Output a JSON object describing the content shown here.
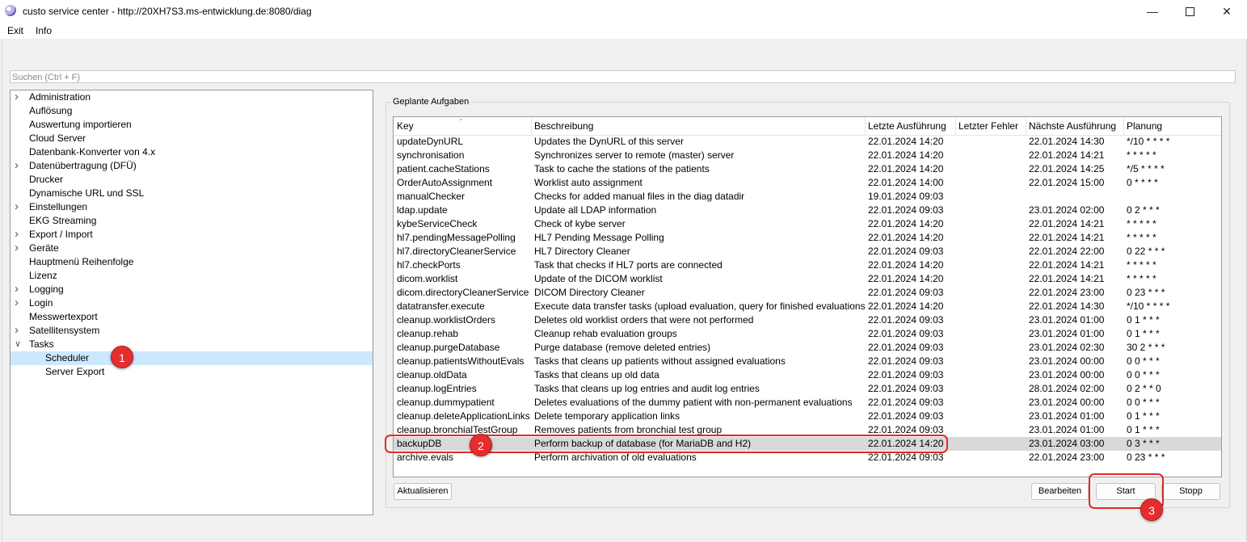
{
  "window": {
    "title": "custo service center - http://20XH7S3.ms-entwicklung.de:8080/diag"
  },
  "menu": {
    "items": [
      "Exit",
      "Info"
    ]
  },
  "search": {
    "placeholder": "Suchen (Ctrl + F)"
  },
  "tree": {
    "items": [
      {
        "label": "Administration",
        "expandable": true
      },
      {
        "label": "Auflösung",
        "expandable": false
      },
      {
        "label": "Auswertung importieren",
        "expandable": false
      },
      {
        "label": "Cloud Server",
        "expandable": false
      },
      {
        "label": "Datenbank-Konverter von 4.x",
        "expandable": false
      },
      {
        "label": "Datenübertragung (DFÜ)",
        "expandable": true
      },
      {
        "label": "Drucker",
        "expandable": false
      },
      {
        "label": "Dynamische URL und SSL",
        "expandable": false
      },
      {
        "label": "Einstellungen",
        "expandable": true
      },
      {
        "label": "EKG Streaming",
        "expandable": false
      },
      {
        "label": "Export / Import",
        "expandable": true
      },
      {
        "label": "Geräte",
        "expandable": true
      },
      {
        "label": "Hauptmenü Reihenfolge",
        "expandable": false
      },
      {
        "label": "Lizenz",
        "expandable": false
      },
      {
        "label": "Logging",
        "expandable": true
      },
      {
        "label": "Login",
        "expandable": true
      },
      {
        "label": "Messwertexport",
        "expandable": false
      },
      {
        "label": "Satellitensystem",
        "expandable": true
      },
      {
        "label": "Tasks",
        "expandable": true,
        "expanded": true
      },
      {
        "label": "Scheduler",
        "child": true,
        "selected": true
      },
      {
        "label": "Server Export",
        "child": true
      }
    ]
  },
  "panel": {
    "title": "Geplante Aufgaben"
  },
  "table": {
    "columns": [
      "Key",
      "Beschreibung",
      "Letzte Ausführung",
      "Letzter Fehler",
      "Nächste Ausführung",
      "Planung"
    ],
    "rows": [
      [
        "updateDynURL",
        "Updates the DynURL of this server",
        "22.01.2024 14:20",
        "",
        "22.01.2024 14:30",
        "*/10 * * * *"
      ],
      [
        "synchronisation",
        "Synchronizes server to remote (master) server",
        "22.01.2024 14:20",
        "",
        "22.01.2024 14:21",
        "* * * * *"
      ],
      [
        "patient.cacheStations",
        "Task to cache the stations of the patients",
        "22.01.2024 14:20",
        "",
        "22.01.2024 14:25",
        "*/5 * * * *"
      ],
      [
        "OrderAutoAssignment",
        "Worklist auto assignment",
        "22.01.2024 14:00",
        "",
        "22.01.2024 15:00",
        "0 * * * *"
      ],
      [
        "manualChecker",
        "Checks for added manual files in the diag datadir",
        "19.01.2024 09:03",
        "",
        "",
        ""
      ],
      [
        "ldap.update",
        "Update all LDAP information",
        "22.01.2024 09:03",
        "",
        "23.01.2024 02:00",
        "0 2 * * *"
      ],
      [
        "kybeServiceCheck",
        "Check of kybe server",
        "22.01.2024 14:20",
        "",
        "22.01.2024 14:21",
        "* * * * *"
      ],
      [
        "hl7.pendingMessagePolling",
        "HL7 Pending Message Polling",
        "22.01.2024 14:20",
        "",
        "22.01.2024 14:21",
        "* * * * *"
      ],
      [
        "hl7.directoryCleanerService",
        "HL7 Directory Cleaner",
        "22.01.2024 09:03",
        "",
        "22.01.2024 22:00",
        "0 22 * * *"
      ],
      [
        "hl7.checkPorts",
        "Task that checks if HL7 ports are connected",
        "22.01.2024 14:20",
        "",
        "22.01.2024 14:21",
        "* * * * *"
      ],
      [
        "dicom.worklist",
        "Update of the DICOM worklist",
        "22.01.2024 14:20",
        "",
        "22.01.2024 14:21",
        "* * * * *"
      ],
      [
        "dicom.directoryCleanerService",
        "DICOM Directory Cleaner",
        "22.01.2024 09:03",
        "",
        "22.01.2024 23:00",
        "0 23 * * *"
      ],
      [
        "datatransfer.execute",
        "Execute data transfer tasks (upload evaluation, query for finished evaluations)",
        "22.01.2024 14:20",
        "",
        "22.01.2024 14:30",
        "*/10 * * * *"
      ],
      [
        "cleanup.worklistOrders",
        "Deletes old worklist orders that were not performed",
        "22.01.2024 09:03",
        "",
        "23.01.2024 01:00",
        "0 1 * * *"
      ],
      [
        "cleanup.rehab",
        "Cleanup rehab evaluation groups",
        "22.01.2024 09:03",
        "",
        "23.01.2024 01:00",
        "0 1 * * *"
      ],
      [
        "cleanup.purgeDatabase",
        "Purge database (remove deleted entries)",
        "22.01.2024 09:03",
        "",
        "23.01.2024 02:30",
        "30 2 * * *"
      ],
      [
        "cleanup.patientsWithoutEvals",
        "Tasks that cleans up patients without assigned evaluations",
        "22.01.2024 09:03",
        "",
        "23.01.2024 00:00",
        "0 0 * * *"
      ],
      [
        "cleanup.oldData",
        "Tasks that cleans up old data",
        "22.01.2024 09:03",
        "",
        "23.01.2024 00:00",
        "0 0 * * *"
      ],
      [
        "cleanup.logEntries",
        "Tasks that cleans up log entries and audit log entries",
        "22.01.2024 09:03",
        "",
        "28.01.2024 02:00",
        "0 2 * * 0"
      ],
      [
        "cleanup.dummypatient",
        "Deletes evaluations of the dummy patient with non-permanent evaluations",
        "22.01.2024 09:03",
        "",
        "23.01.2024 00:00",
        "0 0 * * *"
      ],
      [
        "cleanup.deleteApplicationLinks",
        "Delete temporary application links",
        "22.01.2024 09:03",
        "",
        "23.01.2024 01:00",
        "0 1 * * *"
      ],
      [
        "cleanup.bronchialTestGroup",
        "Removes patients from bronchial test group",
        "22.01.2024 09:03",
        "",
        "23.01.2024 01:00",
        "0 1 * * *"
      ],
      [
        "backupDB",
        "Perform backup of database (for MariaDB and H2)",
        "22.01.2024 14:20",
        "",
        "23.01.2024 03:00",
        "0 3 * * *"
      ],
      [
        "archive.evals",
        "Perform archivation of old evaluations",
        "22.01.2024 09:03",
        "",
        "22.01.2024 23:00",
        "0 23 * * *"
      ]
    ],
    "selected_row": 22
  },
  "buttons": {
    "refresh": "Aktualisieren",
    "edit": "Bearbeiten",
    "start": "Start",
    "stop": "Stopp"
  },
  "annotations": {
    "badge1": "1",
    "badge2": "2",
    "badge3": "3"
  },
  "colors": {
    "annotation_red": "#e52d2d",
    "tree_selection": "#cce8ff",
    "row_selection": "#d9d9d9"
  }
}
